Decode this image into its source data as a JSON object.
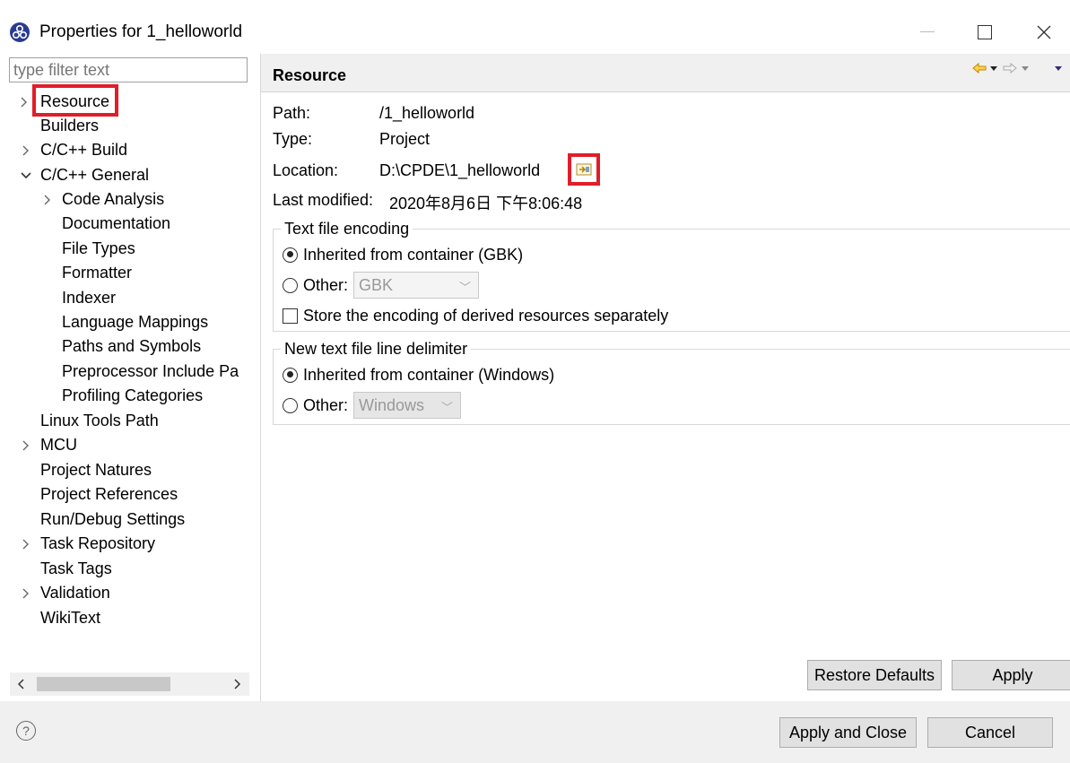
{
  "window": {
    "title": "Properties for 1_helloworld"
  },
  "filter": {
    "placeholder": "type filter text"
  },
  "tree": {
    "items": [
      {
        "label": "Resource",
        "expander": "collapsed-arrow"
      },
      {
        "label": "Builders",
        "expander": ""
      },
      {
        "label": "C/C++ Build",
        "expander": "collapsed-arrow"
      },
      {
        "label": "C/C++ General",
        "expander": "expanded-arrow"
      },
      {
        "label": "Code Analysis",
        "expander": "collapsed-arrow"
      },
      {
        "label": "Documentation",
        "expander": ""
      },
      {
        "label": "File Types",
        "expander": ""
      },
      {
        "label": "Formatter",
        "expander": ""
      },
      {
        "label": "Indexer",
        "expander": ""
      },
      {
        "label": "Language Mappings",
        "expander": ""
      },
      {
        "label": "Paths and Symbols",
        "expander": ""
      },
      {
        "label": "Preprocessor Include Pa",
        "expander": ""
      },
      {
        "label": "Profiling Categories",
        "expander": ""
      },
      {
        "label": "Linux Tools Path",
        "expander": ""
      },
      {
        "label": "MCU",
        "expander": "collapsed-arrow"
      },
      {
        "label": "Project Natures",
        "expander": ""
      },
      {
        "label": "Project References",
        "expander": ""
      },
      {
        "label": "Run/Debug Settings",
        "expander": ""
      },
      {
        "label": "Task Repository",
        "expander": "collapsed-arrow"
      },
      {
        "label": "Task Tags",
        "expander": ""
      },
      {
        "label": "Validation",
        "expander": "collapsed-arrow"
      },
      {
        "label": "WikiText",
        "expander": ""
      }
    ]
  },
  "page": {
    "title": "Resource",
    "path_label": "Path:",
    "path_value": "/1_helloworld",
    "type_label": "Type:",
    "type_value": "Project",
    "location_label": "Location:",
    "location_value": "D:\\CPDE\\1_helloworld",
    "modified_label": "Last modified:",
    "modified_value": "2020年8月6日 下午8:06:48"
  },
  "encoding": {
    "group_title": "Text file encoding",
    "inherited_label": "Inherited from container (GBK)",
    "other_label": "Other:",
    "other_value": "GBK",
    "store_label": "Store the encoding of derived resources separately"
  },
  "delimiter": {
    "group_title": "New text file line delimiter",
    "inherited_label": "Inherited from container (Windows)",
    "other_label": "Other:",
    "other_value": "Windows"
  },
  "buttons": {
    "restore_defaults": "Restore Defaults",
    "apply": "Apply",
    "apply_and_close": "Apply and Close",
    "cancel": "Cancel"
  },
  "icons": {
    "app": "eclipse-icon",
    "help": "help-icon"
  },
  "colors": {
    "highlight_border": "#e01e2a",
    "nav_arrow": "#e8a800"
  }
}
